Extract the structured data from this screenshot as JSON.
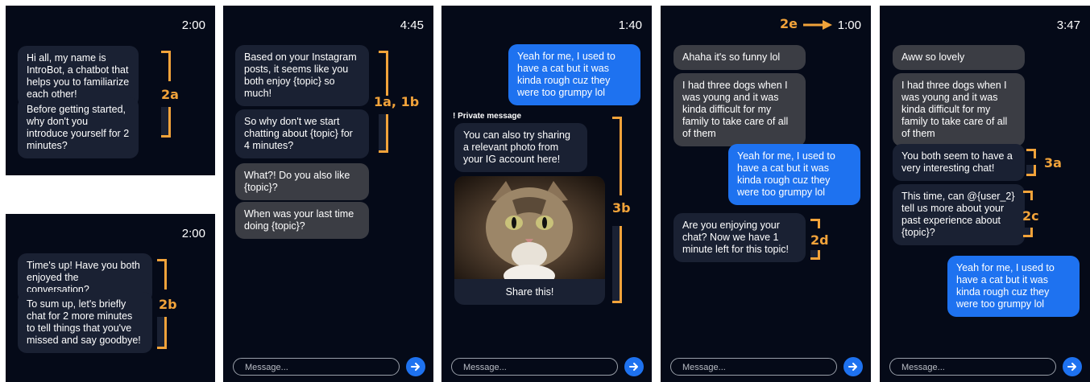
{
  "screen_a": {
    "time": "2:00",
    "bubbles": [
      "Hi all, my name is IntroBot, a chatbot that helps you to familiarize each other!",
      "Before getting started, why don't you introduce yourself for 2 minutes?"
    ],
    "label": "2a"
  },
  "screen_b": {
    "time": "2:00",
    "bubbles": [
      "Time's up! Have you both enjoyed the conversation?",
      "To sum up, let's briefly chat for 2 more minutes to tell things that you've missed and say goodbye!"
    ],
    "label": "2b"
  },
  "screen_c": {
    "time": "4:45",
    "bubbles": [
      "Based on your Instagram posts, it seems like you both enjoy {topic} so much!",
      "So why don't we start chatting about {topic} for 4 minutes?",
      "What?! Do you also like {topic}?",
      "When was your last time doing {topic}?"
    ],
    "label": "1a, 1b",
    "placeholder": "Message..."
  },
  "screen_d": {
    "time": "1:40",
    "bubbles": [
      "Yeah for me, I used to have a cat but it was kinda rough cuz they were too grumpy lol",
      "You can also try sharing a relevant photo from your IG account here!"
    ],
    "private_label": "! Private message",
    "share_label": "Share this!",
    "label": "3b",
    "placeholder": "Message..."
  },
  "screen_e": {
    "time": "1:00",
    "top_label": "2e",
    "bubbles": [
      "Ahaha it's so funny lol",
      "I had three dogs when I was young and it was kinda difficult for my family to take care of all of them",
      "Yeah for me, I used to have a cat but it was kinda rough cuz they were too grumpy lol",
      "Are you enjoying your chat? Now we have 1 minute left for this topic!"
    ],
    "label": "2d",
    "placeholder": "Message..."
  },
  "screen_f": {
    "time": "3:47",
    "bubbles": [
      "Aww so lovely",
      "I had three dogs when I was young and it was kinda difficult for my family to take care of all of them",
      "You both seem to have a very interesting chat!",
      "This time, can @{user_2} tell us more about your past experience about {topic}?",
      "Yeah for me, I used to have a cat but it was kinda rough cuz they were too grumpy lol"
    ],
    "labels": [
      "3a",
      "2c"
    ],
    "placeholder": "Message..."
  },
  "colors": {
    "background": "#050a18",
    "bot_bubble": "#1a2133",
    "user_bubble": "#3b3d44",
    "self_bubble": "#1e72f0",
    "annotation": "#f2a33a"
  }
}
